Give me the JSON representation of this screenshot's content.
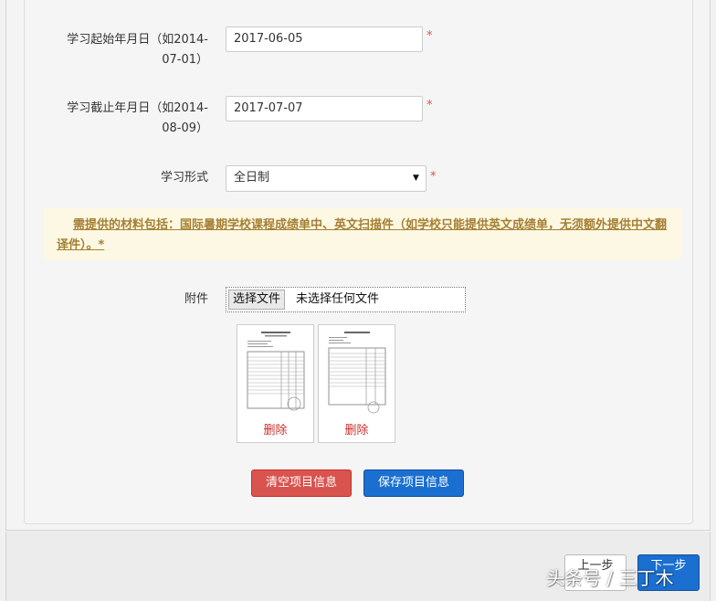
{
  "form": {
    "start_date": {
      "label_line1": "学习起始年月日（如2014-",
      "label_line2": "07-01）",
      "value": "2017-06-05",
      "required_mark": "*"
    },
    "end_date": {
      "label_line1": "学习截止年月日（如2014-",
      "label_line2": "08-09）",
      "value": "2017-07-07",
      "required_mark": "*"
    },
    "study_mode": {
      "label": "学习形式",
      "selected": "全日制",
      "arrow": "▼",
      "required_mark": "*"
    }
  },
  "notice": {
    "text": "需提供的材料包括：国际暑期学校课程成绩单中、英文扫描件（如学校只能提供英文成绩单，无须额外提供中文翻译件）。*"
  },
  "attachment": {
    "label": "附件",
    "choose_button": "选择文件",
    "status": "未选择任何文件",
    "thumbnails": [
      {
        "delete_label": "删除"
      },
      {
        "delete_label": "删除"
      }
    ]
  },
  "actions": {
    "clear_label": "清空项目信息",
    "save_label": "保存项目信息"
  },
  "footer": {
    "prev_label": "上一步",
    "next_label": "下一步"
  },
  "watermark": {
    "text": "头条号 / 三丁木"
  },
  "colors": {
    "danger": "#d9534f",
    "primary": "#1a6fd0",
    "notice_bg": "#fcf8e3",
    "notice_text": "#a57f33",
    "required": "#d9534f"
  }
}
